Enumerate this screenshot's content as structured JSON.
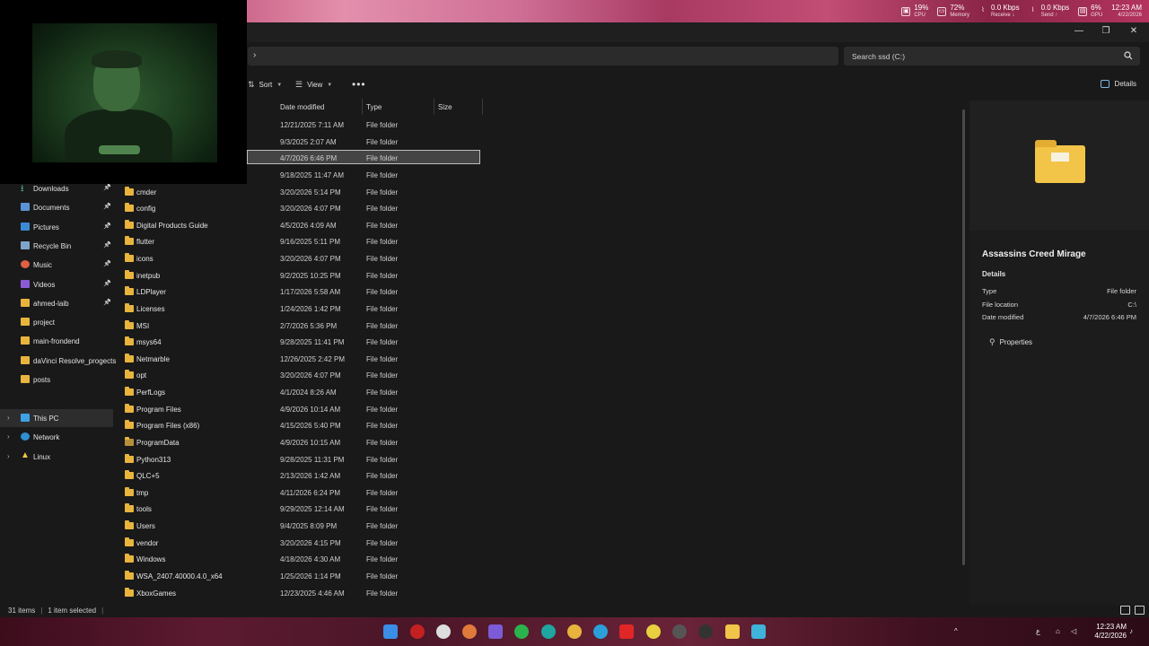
{
  "system_monitor": {
    "cpu": {
      "value": "19%",
      "label": "CPU"
    },
    "memory": {
      "value": "72%",
      "label": "Memory"
    },
    "receive": {
      "value": "0.0 Kbps",
      "label": "Receive ↓"
    },
    "send": {
      "value": "0.0 Kbps",
      "label": "Send ↑"
    },
    "gpu": {
      "value": "6%",
      "label": "GPU"
    },
    "time": "12:23 AM",
    "date": "4/22/2026"
  },
  "address_bar": {
    "chevron": "›"
  },
  "search": {
    "placeholder": "Search ssd (C:)"
  },
  "command_bar": {
    "sort_label": "Sort",
    "view_label": "View",
    "more_label": "•••",
    "details_label": "Details"
  },
  "columns": {
    "date": "Date modified",
    "type": "Type",
    "size": "Size"
  },
  "sidebar": {
    "items": [
      {
        "label": "Downloads",
        "icon": "download-icon",
        "pinned": true
      },
      {
        "label": "Documents",
        "icon": "documents-icon",
        "pinned": true
      },
      {
        "label": "Pictures",
        "icon": "pictures-icon",
        "pinned": true
      },
      {
        "label": "Recycle Bin",
        "icon": "recycle-bin-icon",
        "pinned": true
      },
      {
        "label": "Music",
        "icon": "music-icon",
        "pinned": true
      },
      {
        "label": "Videos",
        "icon": "videos-icon",
        "pinned": true
      },
      {
        "label": "ahmed-laib",
        "icon": "folder-icon",
        "pinned": true
      },
      {
        "label": "project",
        "icon": "folder-icon",
        "pinned": false
      },
      {
        "label": "main-frondend",
        "icon": "folder-icon",
        "pinned": false
      },
      {
        "label": "daVinci Resolve_progects",
        "icon": "folder-icon",
        "pinned": false
      },
      {
        "label": "posts",
        "icon": "folder-icon",
        "pinned": false
      }
    ],
    "drives": [
      {
        "label": "This PC",
        "icon": "this-pc-icon"
      },
      {
        "label": "Network",
        "icon": "network-icon"
      },
      {
        "label": "Linux",
        "icon": "linux-icon"
      }
    ]
  },
  "files": [
    {
      "name": "",
      "date": "12/21/2025 7:11 AM",
      "type": "File folder"
    },
    {
      "name": "",
      "date": "9/3/2025 2:07 AM",
      "type": "File folder"
    },
    {
      "name": "",
      "date": "4/7/2026 6:46 PM",
      "type": "File folder",
      "selected": true
    },
    {
      "name": "",
      "date": "9/18/2025 11:47 AM",
      "type": "File folder"
    },
    {
      "name": "cmder",
      "date": "3/20/2026 5:14 PM",
      "type": "File folder"
    },
    {
      "name": "config",
      "date": "3/20/2026 4:07 PM",
      "type": "File folder"
    },
    {
      "name": "Digital Products Guide",
      "date": "4/5/2026 4:09 AM",
      "type": "File folder"
    },
    {
      "name": "flutter",
      "date": "9/16/2025 5:11 PM",
      "type": "File folder"
    },
    {
      "name": "icons",
      "date": "3/20/2026 4:07 PM",
      "type": "File folder"
    },
    {
      "name": "inetpub",
      "date": "9/2/2025 10:25 PM",
      "type": "File folder"
    },
    {
      "name": "LDPlayer",
      "date": "1/17/2026 5:58 AM",
      "type": "File folder"
    },
    {
      "name": "Licenses",
      "date": "1/24/2026 1:42 PM",
      "type": "File folder"
    },
    {
      "name": "MSI",
      "date": "2/7/2026 5:36 PM",
      "type": "File folder"
    },
    {
      "name": "msys64",
      "date": "9/28/2025 11:41 PM",
      "type": "File folder"
    },
    {
      "name": "Netmarble",
      "date": "12/26/2025 2:42 PM",
      "type": "File folder"
    },
    {
      "name": "opt",
      "date": "3/20/2026 4:07 PM",
      "type": "File folder"
    },
    {
      "name": "PerfLogs",
      "date": "4/1/2024 8:26 AM",
      "type": "File folder"
    },
    {
      "name": "Program Files",
      "date": "4/9/2026 10:14 AM",
      "type": "File folder"
    },
    {
      "name": "Program Files (x86)",
      "date": "4/15/2026 5:40 PM",
      "type": "File folder"
    },
    {
      "name": "ProgramData",
      "date": "4/9/2026 10:15 AM",
      "type": "File folder",
      "dim": true
    },
    {
      "name": "Python313",
      "date": "9/28/2025 11:31 PM",
      "type": "File folder"
    },
    {
      "name": "QLC+5",
      "date": "2/13/2026 1:42 AM",
      "type": "File folder"
    },
    {
      "name": "tmp",
      "date": "4/11/2026 6:24 PM",
      "type": "File folder"
    },
    {
      "name": "tools",
      "date": "9/29/2025 12:14 AM",
      "type": "File folder"
    },
    {
      "name": "Users",
      "date": "9/4/2025 8:09 PM",
      "type": "File folder"
    },
    {
      "name": "vendor",
      "date": "3/20/2026 4:15 PM",
      "type": "File folder"
    },
    {
      "name": "Windows",
      "date": "4/18/2026 4:30 AM",
      "type": "File folder"
    },
    {
      "name": "WSA_2407.40000.4.0_x64",
      "date": "1/25/2026 1:14 PM",
      "type": "File folder"
    },
    {
      "name": "XboxGames",
      "date": "12/23/2025 4:46 AM",
      "type": "File folder"
    }
  ],
  "details_pane": {
    "title": "Assassins Creed Mirage",
    "section": "Details",
    "rows": [
      {
        "key": "Type",
        "value": "File folder"
      },
      {
        "key": "File location",
        "value": "C:\\"
      },
      {
        "key": "Date modified",
        "value": "4/7/2026 6:46 PM"
      }
    ],
    "properties_label": "Properties"
  },
  "status": {
    "items": "31 items",
    "selected": "1 item selected",
    "sep": "|"
  },
  "taskbar": {
    "time": "12:23 AM",
    "date": "4/22/2026",
    "tray_lang": "ع",
    "tray_chevron": "^"
  }
}
